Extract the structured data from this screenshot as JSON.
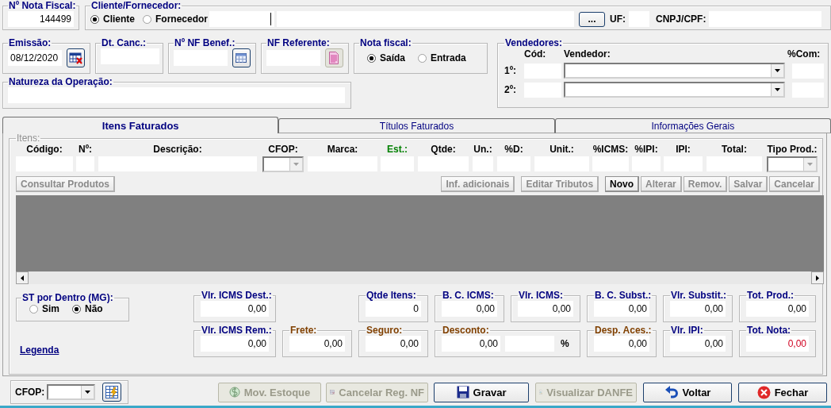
{
  "nota_fiscal": {
    "label": "Nº Nota Fiscal:",
    "value": "144499"
  },
  "cliente_fornecedor": {
    "label": "Cliente/Fornecedor:",
    "options": [
      {
        "label": "Cliente",
        "selected": true
      },
      {
        "label": "Fornecedor",
        "selected": false
      }
    ],
    "browse_button": "...",
    "uf_label": "UF:",
    "cnpj_label": "CNPJ/CPF:"
  },
  "emissao": {
    "label": "Emissão:",
    "value": "08/12/2020"
  },
  "dt_canc": {
    "label": "Dt. Canc.:"
  },
  "nf_benef": {
    "label": "Nº NF Benef.:"
  },
  "nf_referente": {
    "label": "NF Referente:"
  },
  "nota_tipo": {
    "label": "Nota fiscal:",
    "options": [
      {
        "label": "Saída",
        "selected": true
      },
      {
        "label": "Entrada",
        "selected": false
      }
    ]
  },
  "vendedores": {
    "label": "Vendedores:",
    "headers": [
      "Cód:",
      "Vendedor:",
      "%Com:"
    ],
    "rows": [
      {
        "label": "1º:"
      },
      {
        "label": "2º:"
      }
    ]
  },
  "natureza": {
    "label": "Natureza da Operação:"
  },
  "tabs": [
    {
      "label": "Itens Faturados",
      "selected": true
    },
    {
      "label": "Títulos Faturados",
      "selected": false
    },
    {
      "label": "Informações Gerais",
      "selected": false
    }
  ],
  "itens": {
    "label": "Itens:",
    "columns": [
      {
        "label": "Código:",
        "kind": "field",
        "color": "#000000"
      },
      {
        "label": "Nº:",
        "kind": "field",
        "color": "#000000"
      },
      {
        "label": "Descrição:",
        "kind": "field",
        "color": "#000000"
      },
      {
        "label": "CFOP:",
        "kind": "dropdown",
        "color": "#000000"
      },
      {
        "label": "Marca:",
        "kind": "field",
        "color": "#000000"
      },
      {
        "label": "Est.:",
        "kind": "field",
        "color": "#008000"
      },
      {
        "label": "Qtde:",
        "kind": "field",
        "color": "#000000"
      },
      {
        "label": "Un.:",
        "kind": "field",
        "color": "#000000"
      },
      {
        "label": "%D:",
        "kind": "field",
        "color": "#000000"
      },
      {
        "label": "Unit.:",
        "kind": "field",
        "color": "#000000"
      },
      {
        "label": "%ICMS:",
        "kind": "field",
        "color": "#000000"
      },
      {
        "label": "%IPI:",
        "kind": "field",
        "color": "#000000"
      },
      {
        "label": "IPI:",
        "kind": "field",
        "color": "#000000"
      },
      {
        "label": "Total:",
        "kind": "field",
        "color": "#000000"
      },
      {
        "label": "Tipo Prod.:",
        "kind": "dropdown",
        "color": "#000000"
      }
    ],
    "consult_button": {
      "label": "Consultar Produtos",
      "disabled": true
    },
    "buttons": [
      {
        "label": "Inf. adicionais",
        "disabled": true
      },
      {
        "label": "Editar Tributos",
        "disabled": true
      },
      {
        "label": "Novo",
        "disabled": false
      },
      {
        "label": "Alterar",
        "disabled": true
      },
      {
        "label": "Remov.",
        "disabled": true
      },
      {
        "label": "Salvar",
        "disabled": true
      },
      {
        "label": "Cancelar",
        "disabled": true
      }
    ]
  },
  "st_dentro": {
    "label": "ST por Dentro (MG):",
    "options": [
      {
        "label": "Sim",
        "selected": false
      },
      {
        "label": "Não",
        "selected": true
      }
    ]
  },
  "legenda_link": "Legenda",
  "totals": [
    [
      {
        "label": "Vlr. ICMS Dest.:",
        "value": "0,00",
        "color": "#000080",
        "kind": "amount",
        "highlight": false
      },
      {
        "label": "Qtde Itens:",
        "value": "0",
        "color": "#000080",
        "kind": "amount",
        "highlight": false
      },
      {
        "label": "B. C. ICMS:",
        "value": "0,00",
        "color": "#000080",
        "kind": "amount",
        "highlight": false
      },
      {
        "label": "Vlr. ICMS:",
        "value": "0,00",
        "color": "#000080",
        "kind": "amount",
        "highlight": false
      },
      {
        "label": "B. C. Subst.:",
        "value": "0,00",
        "color": "#000080",
        "kind": "amount",
        "highlight": false
      },
      {
        "label": "Vlr. Substit.:",
        "value": "0,00",
        "color": "#000080",
        "kind": "amount",
        "highlight": false
      },
      {
        "label": "Tot. Prod.:",
        "value": "0,00",
        "color": "#000080",
        "kind": "amount",
        "highlight": false
      }
    ],
    [
      {
        "label": "Vlr. ICMS Rem.:",
        "value": "0,00",
        "color": "#000080",
        "kind": "amount",
        "highlight": false
      },
      {
        "label": "Frete:",
        "value": "0,00",
        "color": "#804000",
        "kind": "amount",
        "highlight": false
      },
      {
        "label": "Seguro:",
        "value": "0,00",
        "color": "#804000",
        "kind": "amount",
        "highlight": false
      },
      {
        "label": "Desconto:",
        "value": "0,00",
        "color": "#804000",
        "kind": "discount",
        "unit": "%",
        "highlight": false
      },
      {
        "label": "Desp. Aces.:",
        "value": "0,00",
        "color": "#804000",
        "kind": "amount",
        "highlight": false
      },
      {
        "label": "Vlr. IPI:",
        "value": "0,00",
        "color": "#000080",
        "kind": "amount",
        "highlight": false
      },
      {
        "label": "Tot. Nota:",
        "value": "0,00",
        "color": "#000080",
        "kind": "amount",
        "highlight": true
      }
    ]
  ],
  "cfop": {
    "label": "CFOP:"
  },
  "actions": [
    {
      "label": "Mov. Estoque",
      "kind": "money",
      "disabled": true
    },
    {
      "label": "Cancelar Reg. NF",
      "kind": "grid",
      "disabled": true
    },
    {
      "label": "Gravar",
      "kind": "save",
      "disabled": false
    },
    {
      "label": "Visualizar DANFE",
      "kind": "document",
      "disabled": true
    },
    {
      "label": "Voltar",
      "kind": "undo",
      "disabled": false
    },
    {
      "label": "Fechar",
      "kind": "close",
      "disabled": false
    }
  ]
}
